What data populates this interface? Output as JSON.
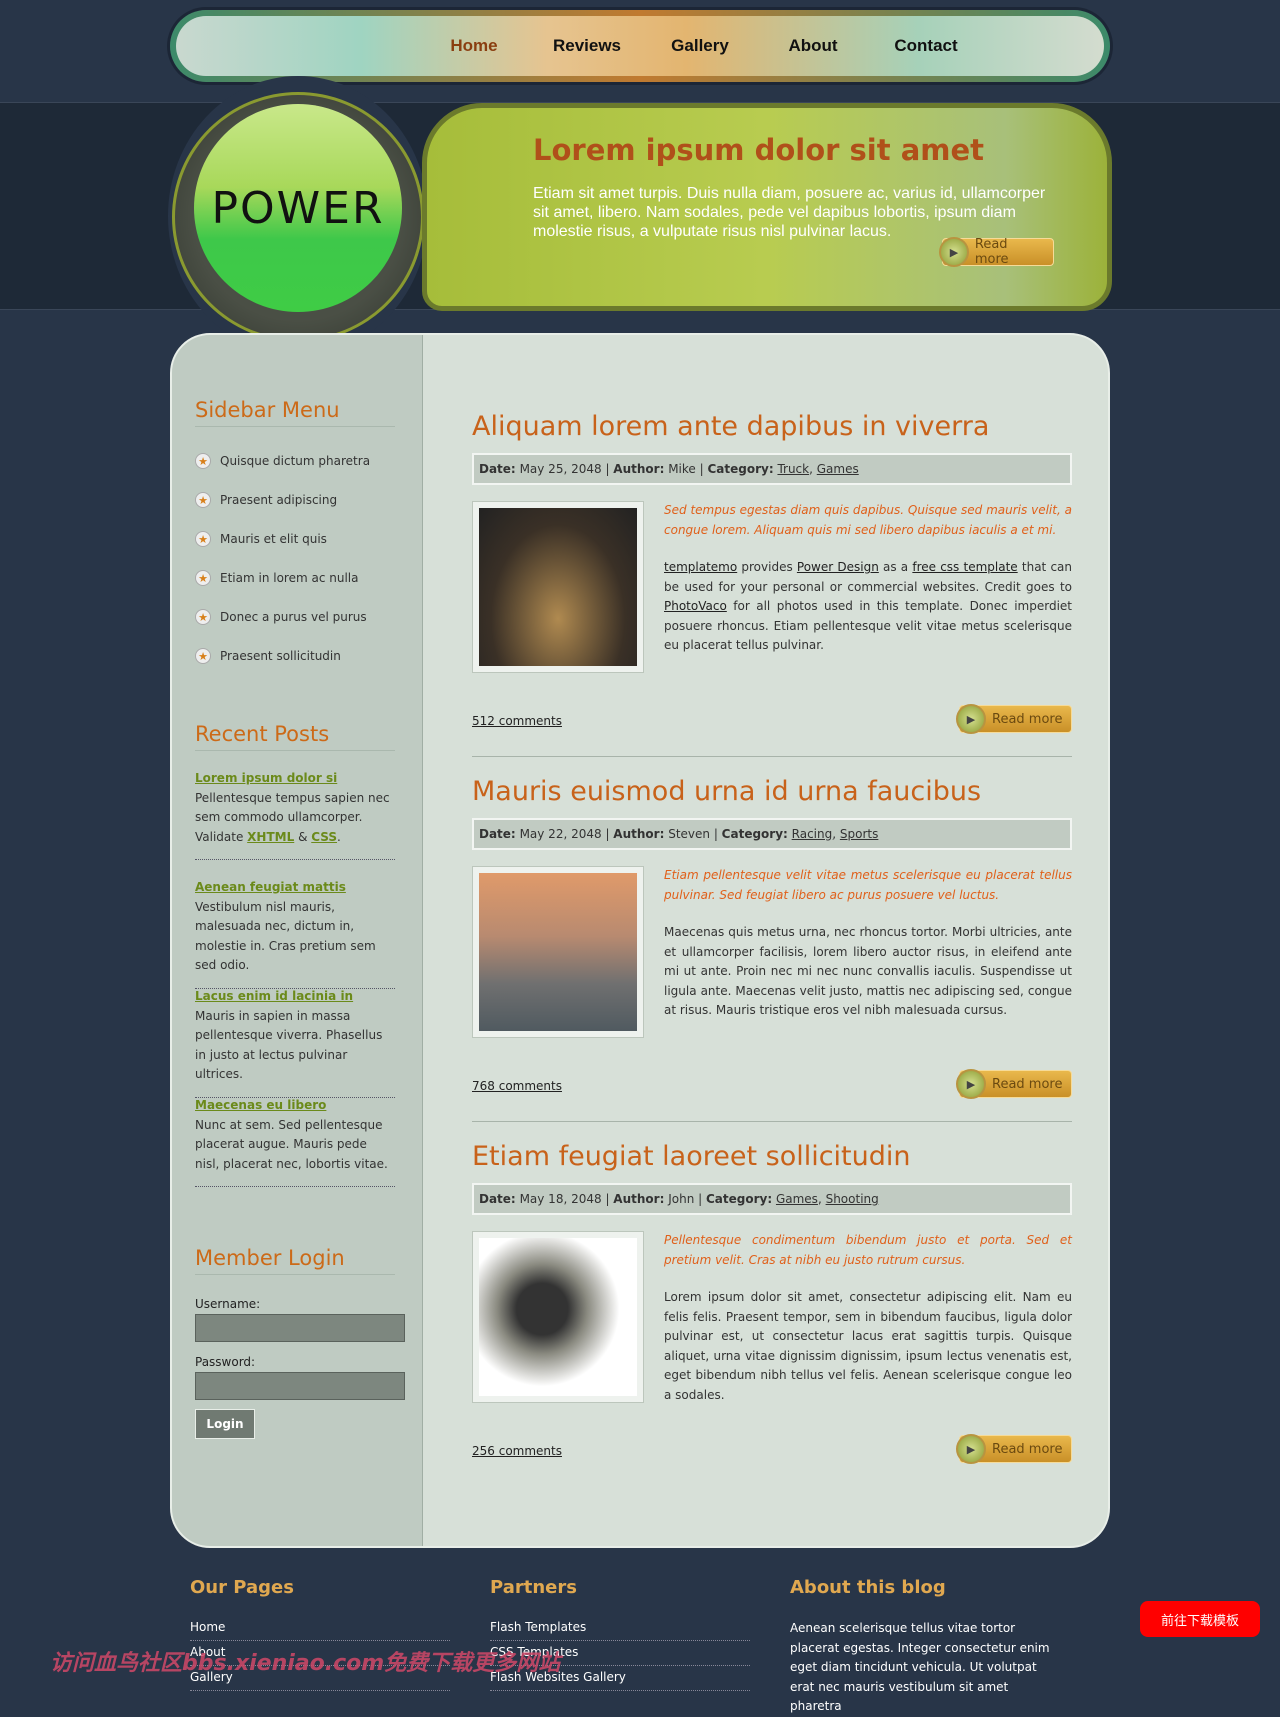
{
  "nav": [
    "Home",
    "Reviews",
    "Gallery",
    "About",
    "Contact"
  ],
  "logo": "POWER",
  "banner": {
    "title": "Lorem ipsum dolor sit amet",
    "text": "Etiam sit amet turpis. Duis nulla diam, posuere ac, varius id, ullamcorper sit amet, libero. Nam sodales, pede vel dapibus lobortis, ipsum diam molestie risus, a vulputate risus nisl pulvinar lacus.",
    "read_more": "Read more"
  },
  "sidebar": {
    "menu_title": "Sidebar Menu",
    "menu": [
      "Quisque dictum pharetra",
      "Praesent adipiscing",
      "Mauris et elit quis",
      "Etiam in lorem ac nulla",
      "Donec a purus vel purus",
      "Praesent sollicitudin"
    ],
    "recent_title": "Recent Posts",
    "recent": [
      {
        "title": "Lorem ipsum dolor si",
        "text": "Pellentesque tempus sapien nec sem commodo ullamcorper. Validate ",
        "xhtml": "XHTML",
        "amp": " & ",
        "css": "CSS",
        "end": "."
      },
      {
        "title": "Aenean feugiat mattis",
        "text": "Vestibulum nisl mauris, malesuada nec, dictum in, molestie in. Cras pretium sem sed odio."
      },
      {
        "title": "Lacus enim id lacinia in",
        "text": "Mauris in sapien in massa pellentesque viverra. Phasellus in justo at lectus pulvinar ultrices."
      },
      {
        "title": "Maecenas eu libero",
        "text": "Nunc at sem. Sed pellentesque placerat augue. Mauris pede nisl, placerat nec, lobortis vitae."
      }
    ],
    "login_title": "Member Login",
    "username_label": "Username:",
    "password_label": "Password:",
    "username_value": "",
    "password_value": "",
    "login_button": "Login"
  },
  "labels": {
    "date": "Date:",
    "author": "Author:",
    "category": "Category:",
    "read_more": "Read more"
  },
  "posts": [
    {
      "title": "Aliquam lorem ante dapibus in viverra",
      "date": "May 25, 2048",
      "author": "Mike",
      "cat1": "Truck",
      "cat2": "Games",
      "intro": "Sed tempus egestas diam quis dapibus. Quisque sed mauris velit, a congue lorem. Aliquam quis mi sed libero dapibus iaculis a et mi.",
      "l1": "templatemo",
      "t1": " provides ",
      "l2": "Power Design",
      "t2": " as a ",
      "l3": "free css template",
      "t3": " that can be used for your personal or commercial websites. Credit goes to ",
      "l4": "PhotoVaco",
      "t4": " for all photos used in this template. Donec imperdiet posuere rhoncus. Etiam pellentesque velit vitae metus scelerisque eu placerat tellus pulvinar.",
      "comments": "512 comments"
    },
    {
      "title": "Mauris euismod urna id urna faucibus",
      "date": "May 22, 2048",
      "author": "Steven",
      "cat1": "Racing",
      "cat2": "Sports",
      "intro": "Etiam pellentesque velit vitae metus scelerisque eu placerat tellus pulvinar. Sed feugiat libero ac purus posuere vel luctus.",
      "body": "Maecenas quis metus urna, nec rhoncus tortor. Morbi ultricies, ante et ullamcorper facilisis, lorem libero auctor risus, in eleifend ante mi ut ante. Proin nec mi nec nunc convallis iaculis. Suspendisse ut ligula ante. Maecenas velit justo, mattis nec adipiscing sed, congue at risus. Mauris tristique eros vel nibh malesuada cursus.",
      "comments": "768 comments"
    },
    {
      "title": "Etiam feugiat laoreet sollicitudin",
      "date": "May 18, 2048",
      "author": "John",
      "cat1": "Games",
      "cat2": "Shooting",
      "intro": "Pellentesque condimentum bibendum justo et porta. Sed et pretium velit. Cras at nibh eu justo rutrum cursus.",
      "body": "Lorem ipsum dolor sit amet, consectetur adipiscing elit. Nam eu felis felis. Praesent tempor, sem in bibendum faucibus, ligula dolor pulvinar est, ut consectetur lacus erat sagittis turpis. Quisque aliquet, urna vitae dignissim dignissim, ipsum lectus venenatis est, eget bibendum nibh tellus vel felis. Aenean scelerisque congue leo a sodales.",
      "comments": "256 comments"
    }
  ],
  "footer": {
    "pages_title": "Our Pages",
    "pages": [
      "Home",
      "About",
      "Gallery"
    ],
    "partners_title": "Partners",
    "partners": [
      "Flash Templates",
      "CSS Templates",
      "Flash Websites Gallery"
    ],
    "about_title": "About this blog",
    "about_text": "Aenean scelerisque tellus vitae tortor placerat egestas. Integer consectetur enim eget diam tincidunt vehicula. Ut volutpat erat nec mauris vestibulum sit amet pharetra"
  },
  "watermark": "访问血鸟社区bbs.xieniao.com免费下载更多网站",
  "download_button": "前往下载模板"
}
